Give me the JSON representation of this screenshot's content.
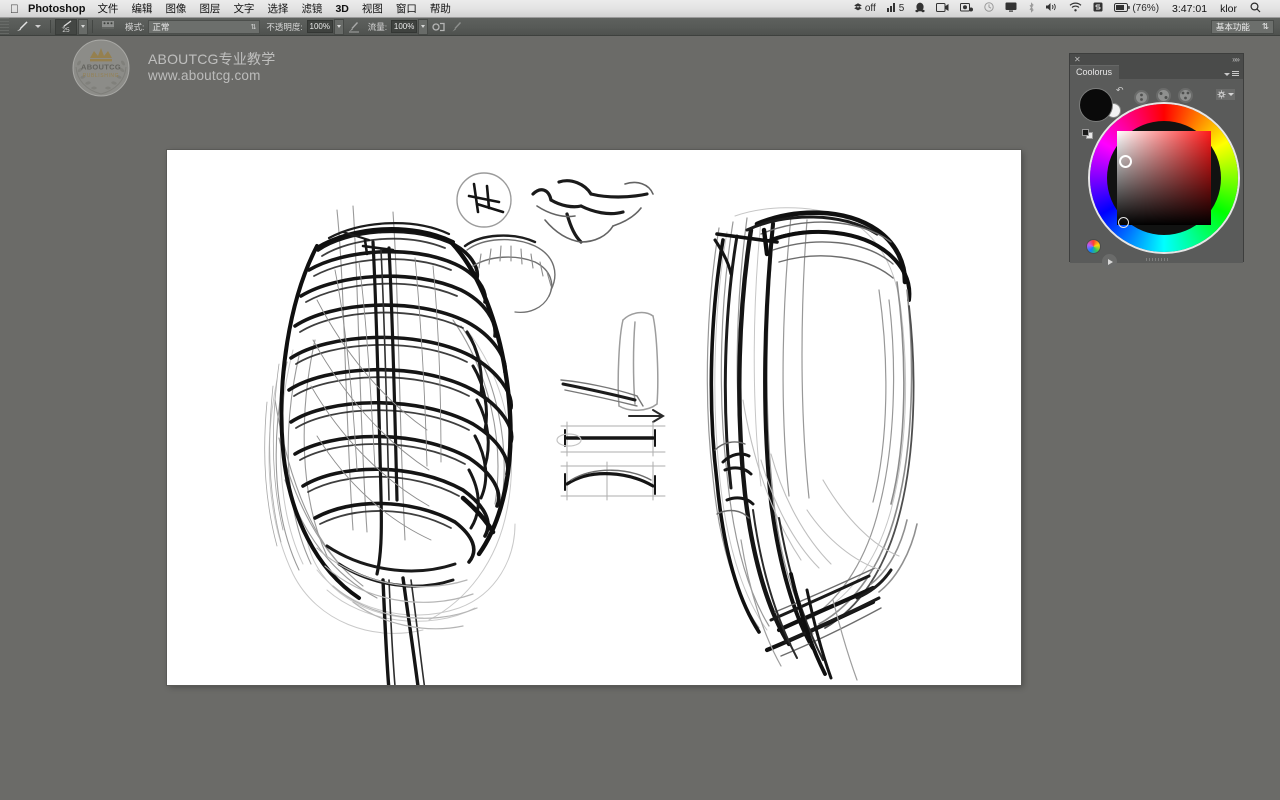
{
  "menubar": {
    "apple_icon": "apple-icon",
    "app_name": "Photoshop",
    "items": [
      {
        "label": "文件",
        "name": "menu-file"
      },
      {
        "label": "编辑",
        "name": "menu-edit"
      },
      {
        "label": "图像",
        "name": "menu-image"
      },
      {
        "label": "图层",
        "name": "menu-layer"
      },
      {
        "label": "文字",
        "name": "menu-type"
      },
      {
        "label": "选择",
        "name": "menu-select"
      },
      {
        "label": "滤镜",
        "name": "menu-filter"
      },
      {
        "label": "3D",
        "name": "menu-3d"
      },
      {
        "label": "视图",
        "name": "menu-view"
      },
      {
        "label": "窗口",
        "name": "menu-window"
      },
      {
        "label": "帮助",
        "name": "menu-help"
      }
    ],
    "status": {
      "dropbox_label": "off",
      "meter_label": "5",
      "battery_percent": "(76%)",
      "clock": "3:47:01",
      "user": "klor",
      "search_icon": "spotlight-search-icon"
    }
  },
  "options_bar": {
    "tool_icon": "brush-tool-icon",
    "brush_size": "25",
    "mode_label": "模式:",
    "mode_value": "正常",
    "opacity_label": "不透明度:",
    "opacity_value": "100%",
    "flow_label": "流量:",
    "flow_value": "100%",
    "airbrush_icon": "airbrush-icon",
    "pressure_opacity_icon": "pressure-opacity-icon",
    "pressure_size_icon": "pressure-size-icon",
    "workspace_value": "基本功能"
  },
  "watermark": {
    "badge_name": "aboutcg-laurel-badge",
    "badge_text": "ABOUTCG",
    "badge_sub": "PUBLISHING",
    "line1": "ABOUTCG专业教学",
    "line2": "www.aboutcg.com"
  },
  "canvas": {
    "name": "photoshop-document-canvas",
    "background_color": "#ffffff",
    "description": "Digital pencil sketch study: human ribcage / thorax from two angles with small anatomical detail studies in the middle column"
  },
  "coolorus": {
    "title": "Coolorus",
    "close_icon": "close-icon",
    "collapse_icon": "collapse-panel-icon",
    "menu_icon": "panel-menu-icon",
    "foreground_color": "#0a0a0a",
    "background_color": "#f3f3f3",
    "swap_icon": "swap-colors-icon",
    "default_colors_icon": "default-colors-icon",
    "gear_icon": "settings-gear-icon",
    "harmony_icons": [
      "harmony-monochromatic-icon",
      "harmony-complementary-icon",
      "harmony-analogous-icon",
      "harmony-triadic-icon",
      "harmony-split-complementary-icon",
      "harmony-tetradic-icon"
    ],
    "color_wheel_icon": "color-wheel-icon",
    "play_icon": "play-icon",
    "hue_marker_color": "#ff2a00",
    "selected_color": "#000000"
  }
}
